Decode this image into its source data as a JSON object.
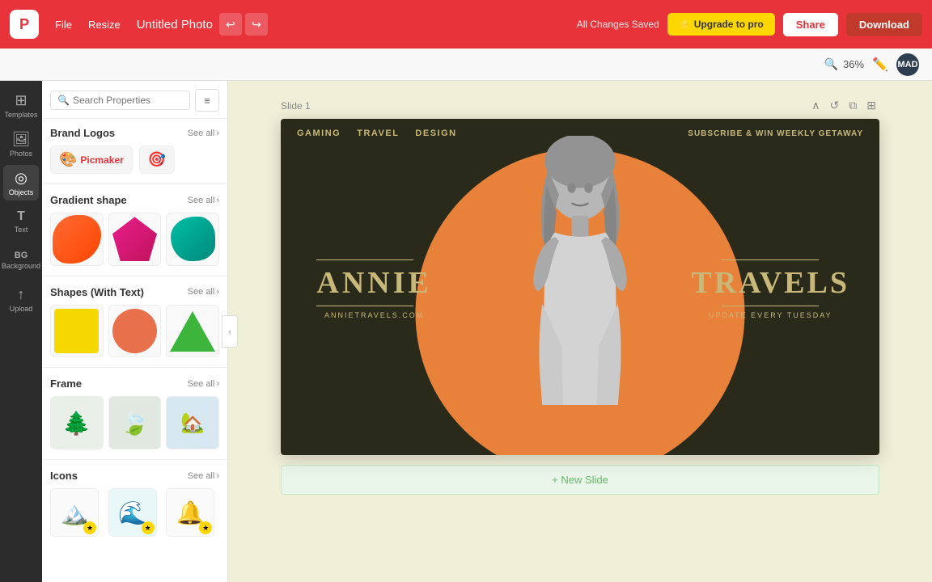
{
  "topbar": {
    "logo": "P",
    "menu": [
      "File",
      "Resize"
    ],
    "title": "Untitled Photo",
    "saved_text": "All Changes Saved",
    "upgrade_label": "Upgrade to pro",
    "share_label": "Share",
    "download_label": "Download",
    "zoom_label": "36%",
    "user_initials": "MAD"
  },
  "search": {
    "placeholder": "Search Properties"
  },
  "sidebar": {
    "rail_items": [
      {
        "id": "templates",
        "icon": "⊞",
        "label": "Templates"
      },
      {
        "id": "photos",
        "icon": "🖼",
        "label": "Photos"
      },
      {
        "id": "objects",
        "icon": "◎",
        "label": "Objects"
      },
      {
        "id": "text",
        "icon": "T",
        "label": "Text"
      },
      {
        "id": "background",
        "icon": "BG",
        "label": "Background"
      },
      {
        "id": "upload",
        "icon": "↑",
        "label": "Upload"
      }
    ]
  },
  "left_panel": {
    "sections": [
      {
        "id": "brand-logos",
        "title": "Brand Logos",
        "see_all": "See all"
      },
      {
        "id": "gradient-shape",
        "title": "Gradient shape",
        "see_all": "See all"
      },
      {
        "id": "shapes-text",
        "title": "Shapes (With Text)",
        "see_all": "See all"
      },
      {
        "id": "frame",
        "title": "Frame",
        "see_all": "See all"
      },
      {
        "id": "icons",
        "title": "Icons",
        "see_all": "See all"
      }
    ]
  },
  "canvas": {
    "slide_label": "Slide 1",
    "new_slide_label": "+ New Slide",
    "slide": {
      "nav_items": [
        "GAMING",
        "TRAVEL",
        "DESIGN"
      ],
      "nav_right": "SUBSCRIBE & WIN WEEKLY GETAWAY",
      "left_name": "ANNIE",
      "right_name": "TRAVELS",
      "website": "ANNIETRAVELS.COM",
      "update": "UPDATE EVERY TUESDAY"
    }
  }
}
